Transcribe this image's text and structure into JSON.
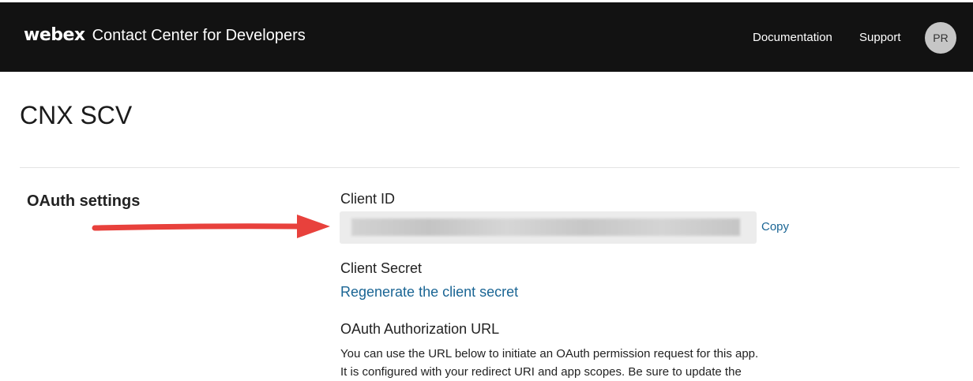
{
  "header": {
    "brand_logo": "webex",
    "brand_sub": "Contact Center for Developers",
    "nav": {
      "documentation": "Documentation",
      "support": "Support"
    },
    "avatar_initials": "PR"
  },
  "page": {
    "title": "CNX SCV"
  },
  "oauth": {
    "section_title": "OAuth settings",
    "client_id_label": "Client ID",
    "client_id_value": "",
    "copy_label": "Copy",
    "client_secret_label": "Client Secret",
    "regenerate_label": "Regenerate the client secret",
    "auth_url_label": "OAuth Authorization URL",
    "description_line1": "You can use the URL below to initiate an OAuth permission request for this app.",
    "description_line2": "It is configured with your redirect URI and app scopes. Be sure to update the"
  },
  "annotation": {
    "arrow_color": "#e8413c",
    "arrow_icon": "arrow-right-icon"
  },
  "colors": {
    "header_bg": "#121212",
    "link": "#1a6594"
  }
}
